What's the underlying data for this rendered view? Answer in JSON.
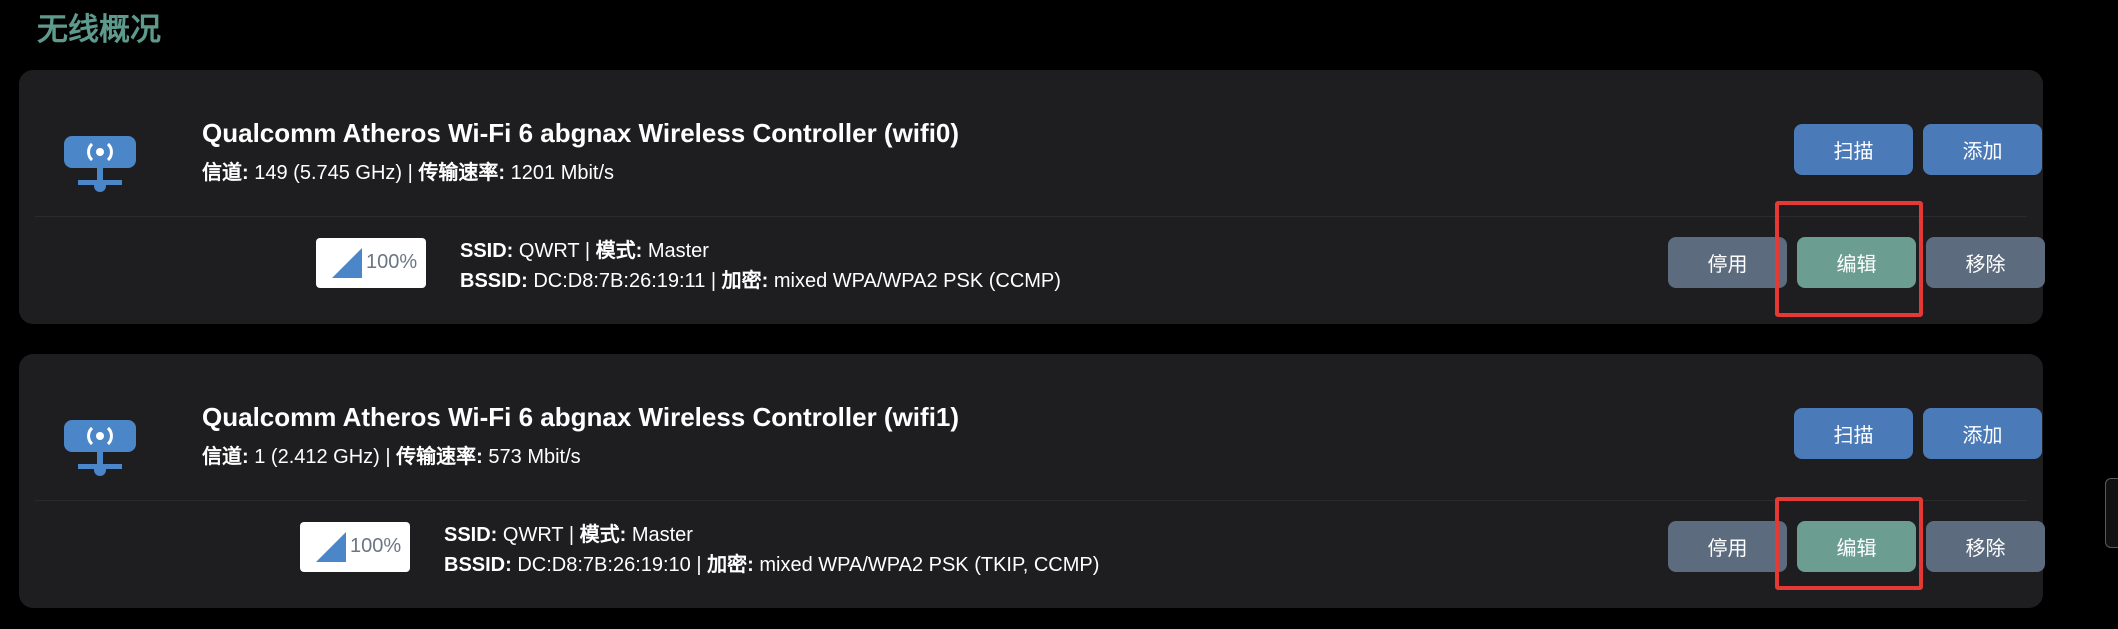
{
  "page": {
    "title": "无线概况"
  },
  "devices": [
    {
      "name": "Qualcomm Atheros Wi-Fi 6 abgnax Wireless Controller (wifi0)",
      "channel_label": "信道:",
      "channel_value": "149 (5.745 GHz)",
      "bitrate_label": "传输速率:",
      "bitrate_value": "1201 Mbit/s",
      "scan_label": "扫描",
      "add_label": "添加",
      "network": {
        "signal": "100%",
        "ssid_label": "SSID:",
        "ssid": "QWRT",
        "mode_label": "模式:",
        "mode": "Master",
        "bssid_label": "BSSID:",
        "bssid": "DC:D8:7B:26:19:11",
        "encryption_label": "加密:",
        "encryption": "mixed WPA/WPA2 PSK (CCMP)",
        "disable_label": "停用",
        "edit_label": "编辑",
        "remove_label": "移除"
      }
    },
    {
      "name": "Qualcomm Atheros Wi-Fi 6 abgnax Wireless Controller (wifi1)",
      "channel_label": "信道:",
      "channel_value": "1 (2.412 GHz)",
      "bitrate_label": "传输速率:",
      "bitrate_value": "573 Mbit/s",
      "scan_label": "扫描",
      "add_label": "添加",
      "network": {
        "signal": "100%",
        "ssid_label": "SSID:",
        "ssid": "QWRT",
        "mode_label": "模式:",
        "mode": "Master",
        "bssid_label": "BSSID:",
        "bssid": "DC:D8:7B:26:19:10",
        "encryption_label": "加密:",
        "encryption": "mixed WPA/WPA2 PSK (TKIP, CCMP)",
        "disable_label": "停用",
        "edit_label": "编辑",
        "remove_label": "移除"
      }
    }
  ],
  "icons": {
    "device": "wireless-router-icon",
    "signal": "signal-strength-icon"
  },
  "colors": {
    "title": "#5d9a8d",
    "primary_button": "#4a7ab8",
    "secondary_button": "#5c6b7e",
    "edit_button": "#6b9d90",
    "highlight": "#e53935",
    "card": "#1e1e20"
  }
}
